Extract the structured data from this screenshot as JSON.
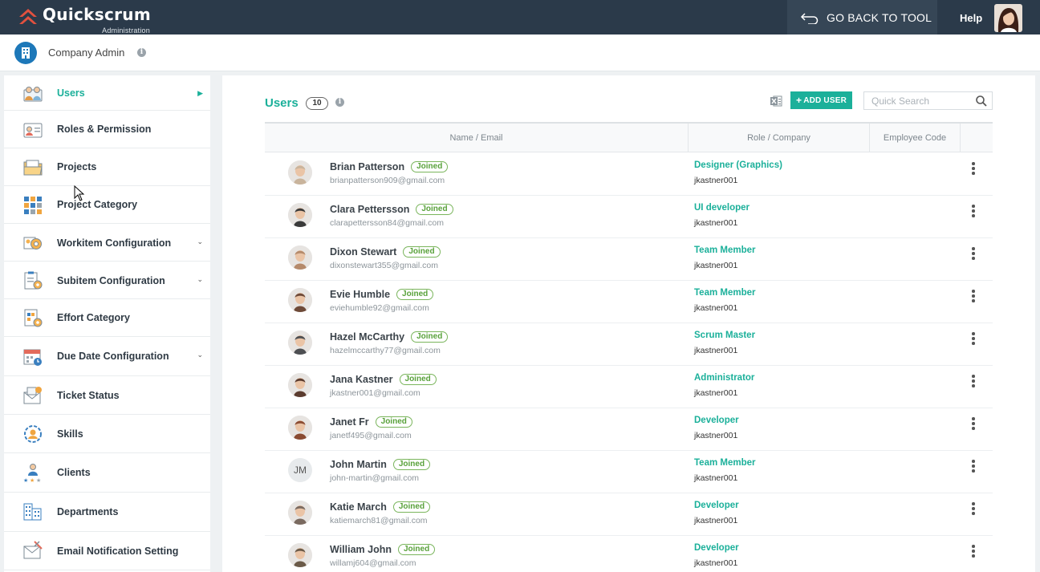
{
  "app": {
    "brand": "Quickscrum",
    "brand_sub": "Administration",
    "go_back_label": "GO BACK TO TOOL",
    "help_label": "Help"
  },
  "header": {
    "title": "Company Admin"
  },
  "sidebar": {
    "items": [
      {
        "label": "Users",
        "icon": "users-icon",
        "active": true,
        "arrow": "right"
      },
      {
        "label": "Roles & Permission",
        "icon": "id-card-icon"
      },
      {
        "label": "Projects",
        "icon": "folder-icon"
      },
      {
        "label": "Project Category",
        "icon": "grid-icon"
      },
      {
        "label": "Workitem Configuration",
        "icon": "gear-icon",
        "arrow": "down"
      },
      {
        "label": "Subitem Configuration",
        "icon": "clipboard-gear-icon",
        "arrow": "down"
      },
      {
        "label": "Effort Category",
        "icon": "document-gear-icon"
      },
      {
        "label": "Due Date Configuration",
        "icon": "calendar-icon",
        "arrow": "down"
      },
      {
        "label": "Ticket Status",
        "icon": "ticket-mail-icon"
      },
      {
        "label": "Skills",
        "icon": "skills-icon"
      },
      {
        "label": "Clients",
        "icon": "client-stars-icon"
      },
      {
        "label": "Departments",
        "icon": "building-icon"
      },
      {
        "label": "Email Notification Setting",
        "icon": "email-settings-icon"
      }
    ]
  },
  "main": {
    "title": "Users",
    "count": "10",
    "add_user_label": "ADD USER",
    "search_placeholder": "Quick Search",
    "columns": [
      "Name / Email",
      "Role / Company",
      "Employee Code",
      ""
    ],
    "joined_label": "Joined",
    "users": [
      {
        "name": "Brian Patterson",
        "email": "brianpatterson909@gmail.com",
        "role": "Designer (Graphics)",
        "company": "jkastner001",
        "avatar": "photo",
        "avatar_color": "#c9b49c"
      },
      {
        "name": "Clara Pettersson",
        "email": "clarapettersson84@gmail.com",
        "role": "UI developer",
        "company": "jkastner001",
        "avatar": "photo",
        "avatar_color": "#3a3a3a"
      },
      {
        "name": "Dixon Stewart",
        "email": "dixonstewart355@gmail.com",
        "role": "Team Member",
        "company": "jkastner001",
        "avatar": "photo",
        "avatar_color": "#b58a6b"
      },
      {
        "name": "Evie Humble",
        "email": "eviehumble92@gmail.com",
        "role": "Team Member",
        "company": "jkastner001",
        "avatar": "photo",
        "avatar_color": "#6e4a38"
      },
      {
        "name": "Hazel McCarthy",
        "email": "hazelmccarthy77@gmail.com",
        "role": "Scrum Master",
        "company": "jkastner001",
        "avatar": "photo",
        "avatar_color": "#4d4f52"
      },
      {
        "name": "Jana Kastner",
        "email": "jkastner001@gmail.com",
        "role": "Administrator",
        "company": "jkastner001",
        "avatar": "photo",
        "avatar_color": "#5b3b2e"
      },
      {
        "name": "Janet Fr",
        "email": "janetf495@gmail.com",
        "role": "Developer",
        "company": "jkastner001",
        "avatar": "photo",
        "avatar_color": "#8a4b32"
      },
      {
        "name": "John Martin",
        "email": "john-martin@gmail.com",
        "role": "Team Member",
        "company": "jkastner001",
        "avatar": "initials",
        "initials": "JM"
      },
      {
        "name": "Katie March",
        "email": "katiemarch81@gmail.com",
        "role": "Developer",
        "company": "jkastner001",
        "avatar": "photo",
        "avatar_color": "#7a6a60"
      },
      {
        "name": "William John",
        "email": "willamj604@gmail.com",
        "role": "Developer",
        "company": "jkastner001",
        "avatar": "photo",
        "avatar_color": "#6b5a48"
      }
    ]
  },
  "colors": {
    "topbar": "#2b3a4a",
    "accent": "#1bb09a",
    "brand_icon": "#1d78b9",
    "joined_badge": "#58a13a"
  }
}
